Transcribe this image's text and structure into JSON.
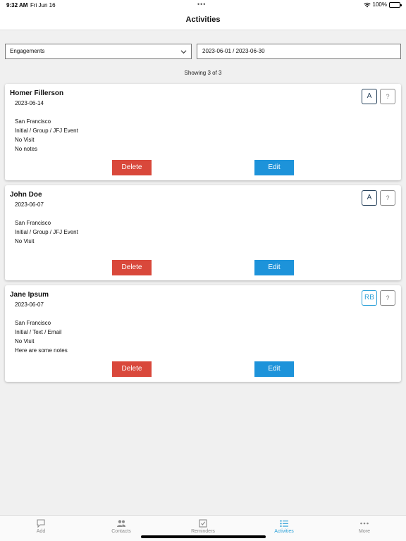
{
  "status_bar": {
    "time": "9:32 AM",
    "date": "Fri Jun 16",
    "battery": "100%"
  },
  "nav": {
    "title": "Activities"
  },
  "filters": {
    "type_selected": "Engagements",
    "date_range": "2023-06-01 / 2023-06-30"
  },
  "showing": "Showing 3 of 3",
  "cards": [
    {
      "name": "Homer Fillerson",
      "date": "2023-06-14",
      "location": "San Francisco",
      "type": "Initial / Group / JFJ Event",
      "visit": "No Visit",
      "notes": "No notes",
      "badge_primary": "A",
      "badge_secondary": "?",
      "delete_label": "Delete",
      "edit_label": "Edit"
    },
    {
      "name": "John Doe",
      "date": "2023-06-07",
      "location": "San Francisco",
      "type": "Initial / Group / JFJ Event",
      "visit": "No Visit",
      "notes": "",
      "badge_primary": "A",
      "badge_secondary": "?",
      "delete_label": "Delete",
      "edit_label": "Edit"
    },
    {
      "name": "Jane Ipsum",
      "date": "2023-06-07",
      "location": "San Francisco",
      "type": "Initial / Text / Email",
      "visit": "No Visit",
      "notes": "Here are some notes",
      "badge_primary": "RB",
      "badge_secondary": "?",
      "delete_label": "Delete",
      "edit_label": "Edit"
    }
  ],
  "tabs": [
    {
      "label": "Add",
      "icon": "chat-bubble-icon"
    },
    {
      "label": "Contacts",
      "icon": "people-icon"
    },
    {
      "label": "Reminders",
      "icon": "checkbox-icon"
    },
    {
      "label": "Activities",
      "icon": "list-icon"
    },
    {
      "label": "More",
      "icon": "more-dots-icon"
    }
  ],
  "colors": {
    "delete": "#d9483b",
    "edit": "#1d93da",
    "active_tab": "#2aa0d8",
    "badge_dark": "#25405a"
  }
}
